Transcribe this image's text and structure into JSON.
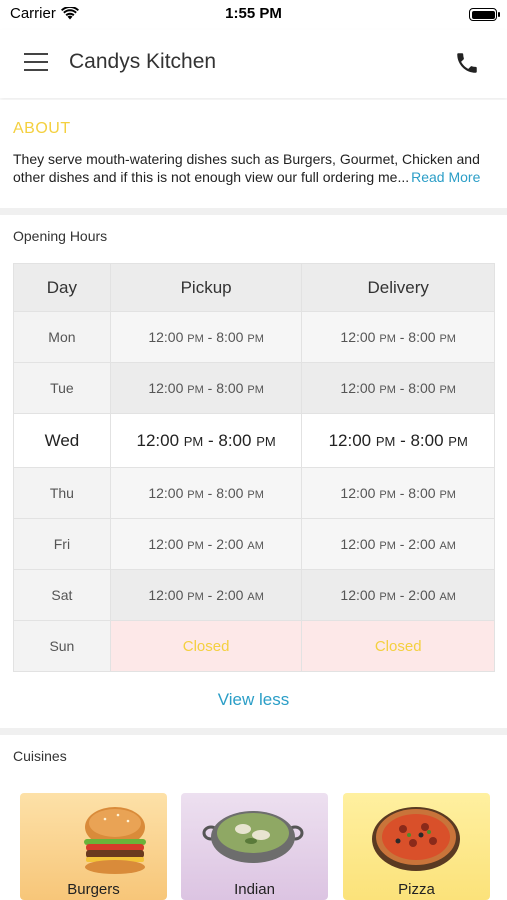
{
  "status_bar": {
    "carrier": "Carrier",
    "time": "1:55 PM",
    "battery_level": 1.0
  },
  "header": {
    "title": "Candys Kitchen",
    "menu_icon": "hamburger-icon",
    "call_icon": "phone-icon"
  },
  "about": {
    "title": "ABOUT",
    "line1": "They serve mouth-watering dishes such as Burgers, Gourmet, Chicken and",
    "line2": "other dishes and if this is not enough view our full ordering me",
    "ellipsis": "...",
    "read_more": "Read More"
  },
  "hours": {
    "label": "Opening Hours",
    "headers": {
      "day": "Day",
      "pickup": "Pickup",
      "delivery": "Delivery"
    },
    "rows": [
      {
        "day": "Mon",
        "pickup": [
          "12:00",
          "PM",
          " - 8:00",
          "PM"
        ],
        "delivery": [
          "12:00",
          "PM",
          " - 8:00",
          "PM"
        ]
      },
      {
        "day": "Tue",
        "pickup": [
          "12:00",
          "PM",
          " - 8:00",
          "PM"
        ],
        "delivery": [
          "12:00",
          "PM",
          " - 8:00",
          "PM"
        ]
      },
      {
        "day": "Wed",
        "pickup": [
          "12:00",
          "PM",
          " - 8:00",
          "PM"
        ],
        "delivery": [
          "12:00",
          "PM",
          " - 8:00",
          "PM"
        ]
      },
      {
        "day": "Thu",
        "pickup": [
          "12:00",
          "PM",
          " - 8:00",
          "PM"
        ],
        "delivery": [
          "12:00",
          "PM",
          " - 8:00",
          "PM"
        ]
      },
      {
        "day": "Fri",
        "pickup": [
          "12:00",
          "PM",
          " - 2:00",
          "AM"
        ],
        "delivery": [
          "12:00",
          "PM",
          " - 2:00",
          "AM"
        ]
      },
      {
        "day": "Sat",
        "pickup": [
          "12:00",
          "PM",
          " - 2:00",
          "AM"
        ],
        "delivery": [
          "12:00",
          "PM",
          " - 2:00",
          "AM"
        ]
      },
      {
        "day": "Sun",
        "pickup_closed": "Closed",
        "delivery_closed": "Closed"
      }
    ],
    "view_less": "View less"
  },
  "cuisines": {
    "label": "Cuisines",
    "items": [
      {
        "name": "Burgers",
        "icon": "burger-icon"
      },
      {
        "name": "Indian",
        "icon": "curry-bowl-icon"
      },
      {
        "name": "Pizza",
        "icon": "pizza-icon"
      }
    ]
  },
  "colors": {
    "accent_yellow": "#f4d03f",
    "link_blue": "#2b9ec7",
    "closed_bg": "#fde8e8"
  }
}
